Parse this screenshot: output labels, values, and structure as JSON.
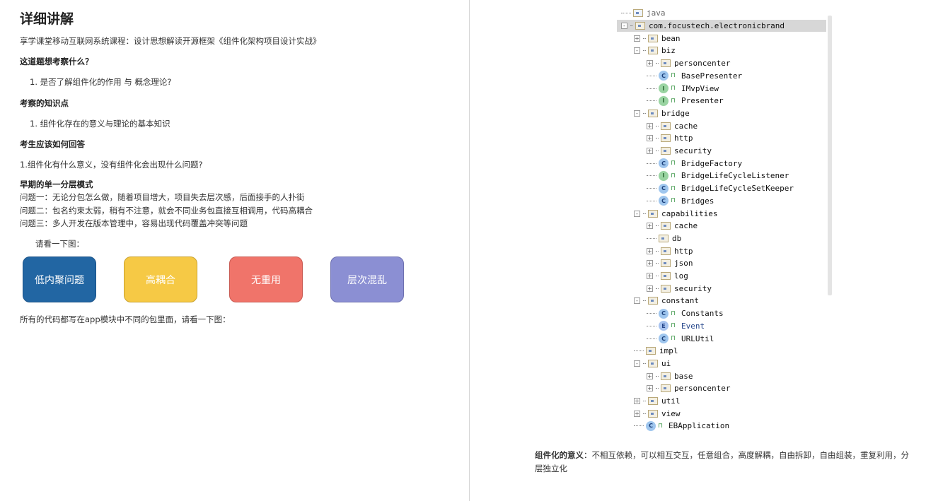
{
  "left": {
    "title": "详细讲解",
    "intro": "享学课堂移动互联网系统课程：设计思想解读开源框架《组件化架构项目设计实战》",
    "q_heading": "这道题想考察什么？",
    "q_item": "1. 是否了解组件化的作用 与 概念理论?",
    "k_heading": "考察的知识点",
    "k_item": "1. 组件化存在的意义与理论的基本知识",
    "a_heading": "考生应该如何回答",
    "a_item": "1.组件化有什么意义，没有组件化会出现什么问题?",
    "early_heading": "早期的单一分层模式",
    "problem1": "问题一：无论分包怎么做，随着项目增大，项目失去层次感，后面接手的人扑街",
    "problem2": "问题二：包名约束太弱，稍有不注意，就会不同业务包直接互相调用，代码高耦合",
    "problem3": "问题三：多人开发在版本管理中，容易出现代码覆盖冲突等问题",
    "see_figure": "请看一下图：",
    "boxes": [
      "低内聚问题",
      "高耦合",
      "无重用",
      "层次混乱"
    ],
    "box_colors": [
      "#2266a3",
      "#f6c945",
      "#f0746a",
      "#8b8fd3"
    ],
    "after_boxes": "所有的代码都写在app模块中不同的包里面，请看一下图："
  },
  "tree": {
    "top_partial": "java",
    "items": [
      {
        "label": "com.focustech.electronicbrand",
        "icon": "package",
        "toggle": "-",
        "level": 0,
        "selected": true
      },
      {
        "label": "bean",
        "icon": "package",
        "toggle": "+",
        "level": 1
      },
      {
        "label": "biz",
        "icon": "package",
        "toggle": "-",
        "level": 1
      },
      {
        "label": "personcenter",
        "icon": "package",
        "toggle": "+",
        "level": 2
      },
      {
        "label": "BasePresenter",
        "icon": "C",
        "level": 2
      },
      {
        "label": "IMvpView",
        "icon": "I",
        "level": 2
      },
      {
        "label": "Presenter",
        "icon": "I",
        "level": 2
      },
      {
        "label": "bridge",
        "icon": "package",
        "toggle": "-",
        "level": 1
      },
      {
        "label": "cache",
        "icon": "package",
        "toggle": "+",
        "level": 2
      },
      {
        "label": "http",
        "icon": "package",
        "toggle": "+",
        "level": 2
      },
      {
        "label": "security",
        "icon": "package",
        "toggle": "+",
        "level": 2
      },
      {
        "label": "BridgeFactory",
        "icon": "C",
        "level": 2
      },
      {
        "label": "BridgeLifeCycleListener",
        "icon": "I",
        "level": 2
      },
      {
        "label": "BridgeLifeCycleSetKeeper",
        "icon": "C",
        "level": 2
      },
      {
        "label": "Bridges",
        "icon": "C",
        "level": 2
      },
      {
        "label": "capabilities",
        "icon": "package",
        "toggle": "-",
        "level": 1
      },
      {
        "label": "cache",
        "icon": "package",
        "toggle": "+",
        "level": 2
      },
      {
        "label": "db",
        "icon": "package",
        "level": 2
      },
      {
        "label": "http",
        "icon": "package",
        "toggle": "+",
        "level": 2
      },
      {
        "label": "json",
        "icon": "package",
        "toggle": "+",
        "level": 2
      },
      {
        "label": "log",
        "icon": "package",
        "toggle": "+",
        "level": 2
      },
      {
        "label": "security",
        "icon": "package",
        "toggle": "+",
        "level": 2
      },
      {
        "label": "constant",
        "icon": "package",
        "toggle": "-",
        "level": 1
      },
      {
        "label": "Constants",
        "icon": "C",
        "level": 2
      },
      {
        "label": "Event",
        "icon": "E",
        "level": 2
      },
      {
        "label": "URLUtil",
        "icon": "C",
        "level": 2
      },
      {
        "label": "impl",
        "icon": "package",
        "level": 1
      },
      {
        "label": "ui",
        "icon": "package",
        "toggle": "-",
        "level": 1
      },
      {
        "label": "base",
        "icon": "package",
        "toggle": "+",
        "level": 2
      },
      {
        "label": "personcenter",
        "icon": "package",
        "toggle": "+",
        "level": 2
      },
      {
        "label": "util",
        "icon": "package",
        "toggle": "+",
        "level": 1
      },
      {
        "label": "view",
        "icon": "package",
        "toggle": "+",
        "level": 1
      },
      {
        "label": "EBApplication",
        "icon": "C",
        "level": 1
      }
    ]
  },
  "right": {
    "meaning_label": "组件化的意义",
    "meaning_text": "：不相互依赖，可以相互交互，任意组合，高度解耦，自由拆卸，自由组装，重复利用，分层独立化"
  }
}
